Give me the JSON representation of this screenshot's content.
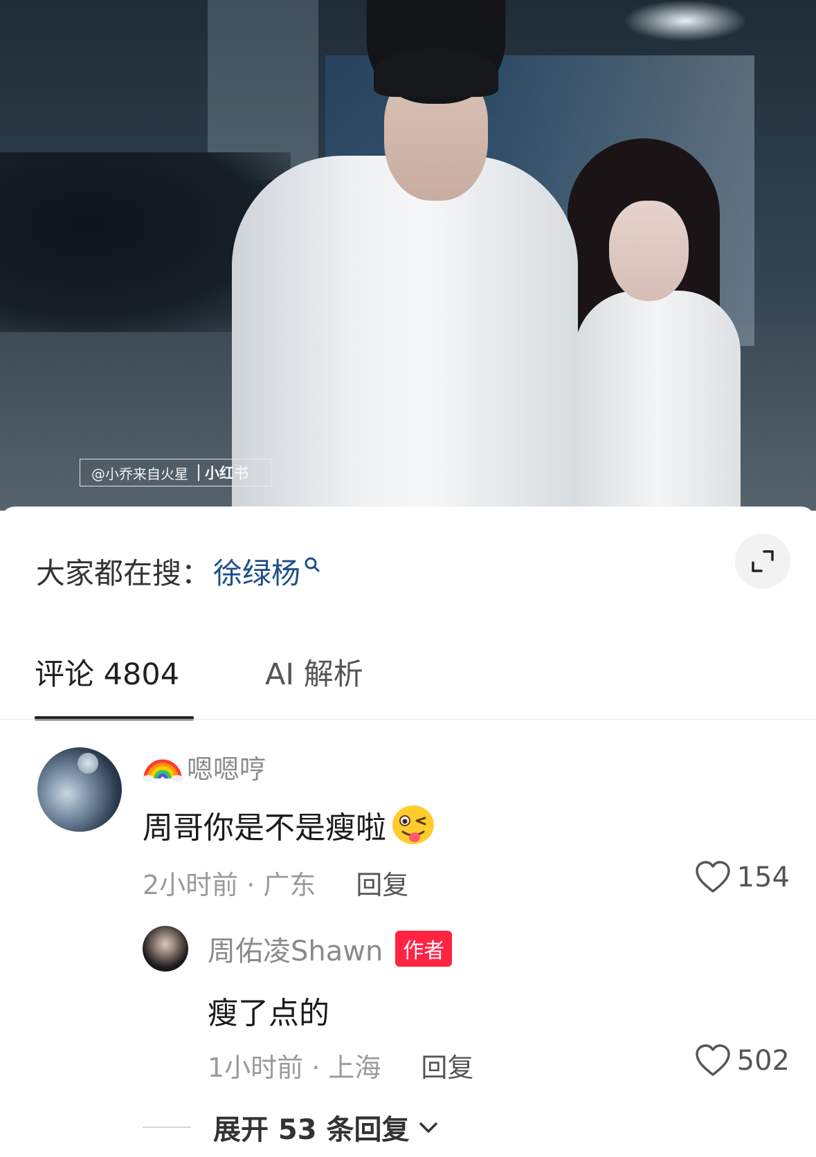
{
  "video": {
    "watermark_handle": "@小乔来自火星",
    "watermark_brand": "小红书"
  },
  "search": {
    "prefix": "大家都在搜：",
    "term": "徐绿杨"
  },
  "tabs": {
    "comments": "评论 4804",
    "ai": "AI 解析"
  },
  "comment": {
    "username": "嗯嗯哼",
    "text": "周哥你是不是瘦啦",
    "time_location": "2小时前 · 广东",
    "reply_label": "回复",
    "likes": "154",
    "username_emoji": "rainbow-icon",
    "text_emoji": "winking-tongue-emoji"
  },
  "reply": {
    "username": "周佑凌Shawn",
    "badge": "作者",
    "text": "瘦了点的",
    "time_location": "1小时前 · 上海",
    "reply_label": "回复",
    "likes": "502"
  },
  "expand": {
    "label": "展开 53 条回复"
  },
  "colors": {
    "author_badge": "#ff2442",
    "search_term": "#1e4f8a"
  }
}
